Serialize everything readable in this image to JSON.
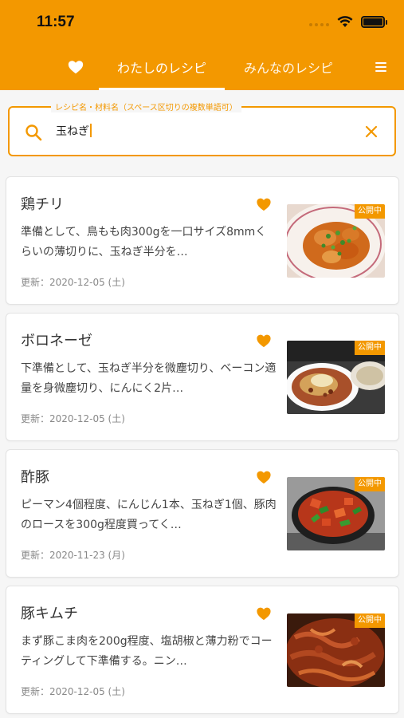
{
  "status_bar": {
    "time": "11:57"
  },
  "tabs": {
    "my_recipes": "わたしのレシピ",
    "all_recipes": "みんなのレシピ"
  },
  "search": {
    "label": "レシピ名・材料名（スペース区切りの複数単語可）",
    "value": "玉ねぎ"
  },
  "colors": {
    "accent": "#f39800",
    "background": "#f6f6f6"
  },
  "recipes": [
    {
      "title": "鶏チリ",
      "description": "準備として、鳥もも肉300gを一口サイズ8mmくらいの薄切りに、玉ねぎ半分を…",
      "updated": "更新：2020-12-05 (土)",
      "badge": "公開中",
      "icon": "heart-icon"
    },
    {
      "title": "ボロネーゼ",
      "description": "下準備として、玉ねぎ半分を微塵切り、ベーコン適量を身微塵切り、にんにく2片…",
      "updated": "更新：2020-12-05 (土)",
      "badge": "公開中",
      "icon": "heart-icon"
    },
    {
      "title": "酢豚",
      "description": "ピーマン4個程度、にんじん1本、玉ねぎ1個、豚肉のロースを300g程度買ってく…",
      "updated": "更新：2020-11-23 (月)",
      "badge": "公開中",
      "icon": "heart-icon"
    },
    {
      "title": "豚キムチ",
      "description": "まず豚こま肉を200g程度、塩胡椒と薄力粉でコーティングして下準備する。ニン…",
      "updated": "更新：2020-12-05 (土)",
      "badge": "公開中",
      "icon": "heart-icon"
    }
  ]
}
